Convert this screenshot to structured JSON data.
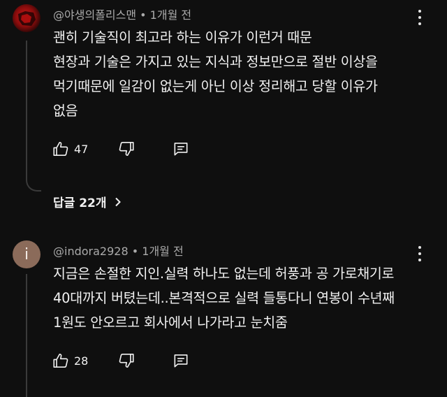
{
  "comments": [
    {
      "author": "@야생의폴리스맨",
      "time": "1개월 전",
      "lines": [
        "괜히 기술직이 최고라 하는 이유가 이런거 때문",
        "현장과 기술은 가지고 있는 지식과 정보만으로 절반 이상을",
        "먹기때문에 일감이 없는게 아닌 이상 정리해고 당할 이유가",
        "없음"
      ],
      "likes": "47",
      "avatar_letter": ""
    },
    {
      "author": "@indora2928",
      "time": "1개월 전",
      "lines": [
        "지금은 손절한 지인.실력 하나도 없는데 허풍과 공 가로채기로",
        "40대까지 버텼는데..본격적으로 실력 들통다니 연봉이 수년째",
        "1원도 안오르고 회사에서 나가라고 눈치줌"
      ],
      "likes": "28",
      "avatar_letter": "i"
    }
  ],
  "replies_label": "답글 22개",
  "meta_separator": "•",
  "icons": {
    "like": "thumbs-up-icon",
    "dislike": "thumbs-down-icon",
    "reply": "comment-icon",
    "more": "kebab-menu-icon",
    "chevron": "chevron-right-icon"
  }
}
